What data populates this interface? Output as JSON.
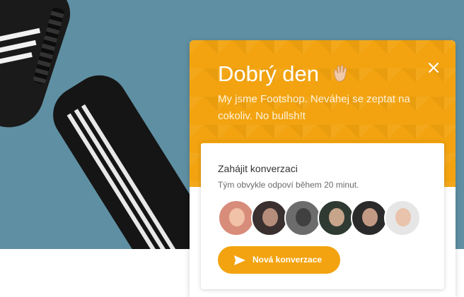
{
  "chat": {
    "title": "Dobrý den",
    "subtitle": "My jsme Footshop. Neváhej se zeptat na cokoliv. No bullsh!t",
    "close_icon": "close-icon",
    "card": {
      "title": "Zahájit konverzaci",
      "subtitle": "Tým obvykle odpoví během 20 minut.",
      "avatars": [
        "team-member-1",
        "team-member-2",
        "team-member-3",
        "team-member-4",
        "team-member-5",
        "team-member-6"
      ],
      "button_label": "Nová konverzace"
    }
  },
  "colors": {
    "accent": "#f2a30f",
    "hero_bg": "#5f8fa2"
  }
}
